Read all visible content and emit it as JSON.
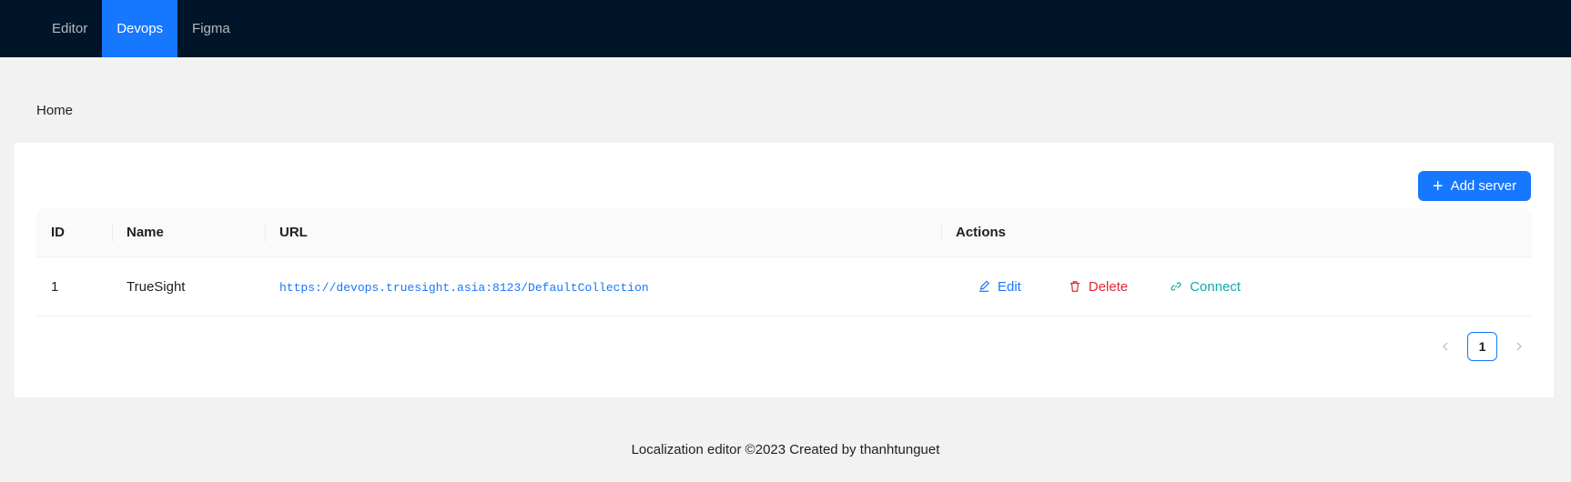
{
  "nav": {
    "items": [
      {
        "label": "Editor",
        "active": false
      },
      {
        "label": "Devops",
        "active": true
      },
      {
        "label": "Figma",
        "active": false
      }
    ]
  },
  "breadcrumb": {
    "home": "Home"
  },
  "toolbar": {
    "add_server_label": "Add server"
  },
  "table": {
    "columns": [
      "ID",
      "Name",
      "URL",
      "Actions"
    ],
    "rows": [
      {
        "id": "1",
        "name": "TrueSight",
        "url": "https://devops.truesight.asia:8123/DefaultCollection",
        "actions": {
          "edit": "Edit",
          "delete": "Delete",
          "connect": "Connect"
        }
      }
    ]
  },
  "pagination": {
    "current_page": "1"
  },
  "footer": {
    "text": "Localization editor ©2023 Created by thanhtunguet"
  },
  "colors": {
    "header_bg": "#001529",
    "primary": "#1677ff",
    "danger": "#e0283a",
    "connect": "#13a8a8",
    "page_bg": "#f2f2f2"
  },
  "icons": [
    "plus-icon",
    "edit-icon",
    "delete-icon",
    "link-icon",
    "chevron-left-icon",
    "chevron-right-icon"
  ]
}
